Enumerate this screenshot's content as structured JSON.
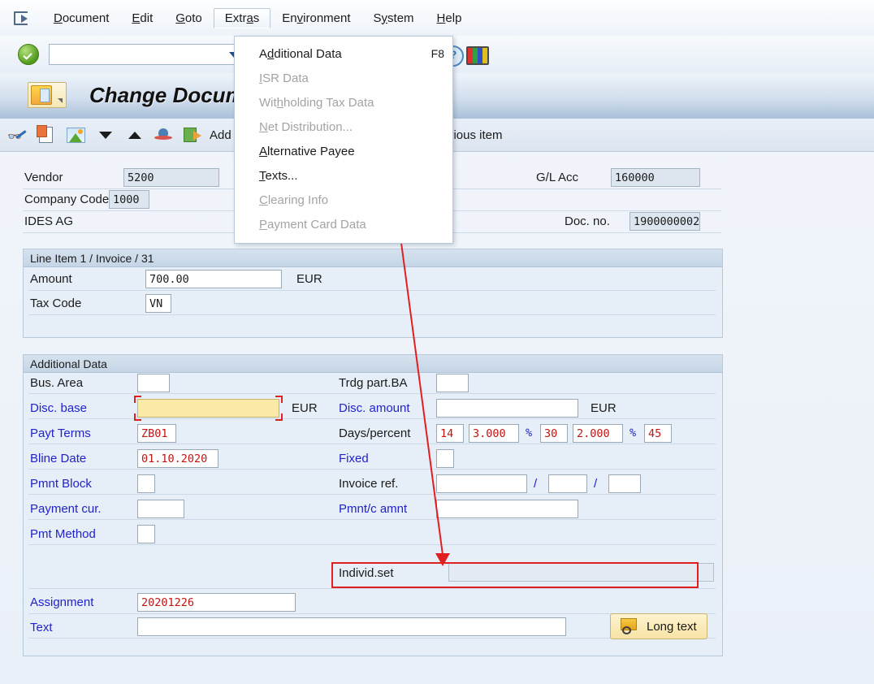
{
  "menubar": {
    "items": [
      {
        "label": "Document",
        "accel": "D",
        "open": false
      },
      {
        "label": "Edit",
        "accel": "E",
        "open": false
      },
      {
        "label": "Goto",
        "accel": "G",
        "open": false
      },
      {
        "label": "Extras",
        "accel": "a",
        "open": true
      },
      {
        "label": "Environment",
        "accel": "v",
        "open": false
      },
      {
        "label": "System",
        "accel": "y",
        "open": false
      },
      {
        "label": "Help",
        "accel": "H",
        "open": false
      }
    ]
  },
  "dropdown": {
    "items": [
      {
        "label": "Additional Data",
        "shortcut": "F8",
        "disabled": false,
        "highlighted": false
      },
      {
        "label": "ISR Data",
        "shortcut": "",
        "disabled": true,
        "highlighted": false
      },
      {
        "label": "Withholding Tax Data",
        "shortcut": "",
        "disabled": true,
        "highlighted": false
      },
      {
        "label": "Net Distribution...",
        "shortcut": "",
        "disabled": true,
        "highlighted": false
      },
      {
        "label": "Alternative Payee",
        "shortcut": "",
        "disabled": false,
        "highlighted": true
      },
      {
        "label": "Texts...",
        "shortcut": "",
        "disabled": false,
        "highlighted": false
      },
      {
        "label": "Clearing Info",
        "shortcut": "",
        "disabled": true,
        "highlighted": false
      },
      {
        "label": "Payment Card Data",
        "shortcut": "",
        "disabled": true,
        "highlighted": false
      }
    ]
  },
  "toolbar": {
    "command_value": "",
    "icons": [
      "create-page-icon",
      "open-page-icon",
      "save-page-icon",
      "change-page-icon",
      "new-window-icon",
      "return-window-icon",
      "help-icon",
      "customize-icon"
    ]
  },
  "title": {
    "text": "Change Document",
    "icon": "document-overview-icon"
  },
  "fnbar": {
    "icons": [
      "display-change-icon",
      "copy-icon",
      "overview-icon",
      "next-item-icon",
      "previous-item-icon",
      "account-model-icon",
      "export-icon"
    ],
    "labels": [
      {
        "name": "additional-data-label",
        "text": "Add"
      },
      {
        "name": "previous-item-label",
        "text": "+ Previous item"
      }
    ]
  },
  "header": {
    "vendor_label": "Vendor",
    "vendor_value": "5200",
    "company_code_label": "Company Code",
    "company_code_value": "1000",
    "company_name": "IDES AG",
    "gl_acc_label": "G/L Acc",
    "gl_acc_value": "160000",
    "doc_no_label": "Doc. no.",
    "doc_no_value": "1900000002"
  },
  "line_item": {
    "section_title": "Line Item 1 / Invoice / 31",
    "amount_label": "Amount",
    "amount_value": "700.00",
    "amount_currency": "EUR",
    "tax_code_label": "Tax Code",
    "tax_code_value": "VN"
  },
  "additional_data": {
    "section_title": "Additional Data",
    "left": [
      {
        "label": "Bus. Area",
        "value": "",
        "blue": false
      },
      {
        "label": "Disc. base",
        "value": "",
        "blue": true,
        "suffix": "EUR"
      },
      {
        "label": "Payt Terms",
        "value": "ZB01",
        "blue": true
      },
      {
        "label": "Bline Date",
        "value": "01.10.2020",
        "blue": true
      },
      {
        "label": "Pmnt Block",
        "value": "",
        "blue": true
      },
      {
        "label": "Payment cur.",
        "value": "",
        "blue": true
      },
      {
        "label": "Pmt Method",
        "value": "",
        "blue": true
      }
    ],
    "right": [
      {
        "label": "Trdg part.BA",
        "value": "",
        "blue": false
      },
      {
        "label": "Disc. amount",
        "value": "",
        "blue": true,
        "suffix": "EUR"
      },
      {
        "label": "Days/percent",
        "value": "",
        "blue": false
      },
      {
        "label": "Fixed",
        "value": "",
        "blue": true
      },
      {
        "label": "Invoice ref.",
        "value": "",
        "blue": false
      },
      {
        "label": "Pmnt/c amnt",
        "value": "",
        "blue": true
      }
    ],
    "days_percent": {
      "days1": "14",
      "pct1": "3.000",
      "pct_sign1": "%",
      "days2": "30",
      "pct2": "2.000",
      "pct_sign2": "%",
      "days3": "45"
    },
    "invoice_ref": {
      "doc": "",
      "sep1": "/",
      "year": "",
      "sep2": "/",
      "item": ""
    },
    "individ_set_label": "Individ.set",
    "individ_set_value": "",
    "assignment_label": "Assignment",
    "assignment_value": "20201226",
    "text_label": "Text",
    "text_value": "",
    "long_text_button": "Long text"
  },
  "colors": {
    "highlight_red": "#e02020",
    "focus_yellow": "#fbe9a7",
    "label_blue": "#2222cc",
    "value_red": "#c01515"
  }
}
